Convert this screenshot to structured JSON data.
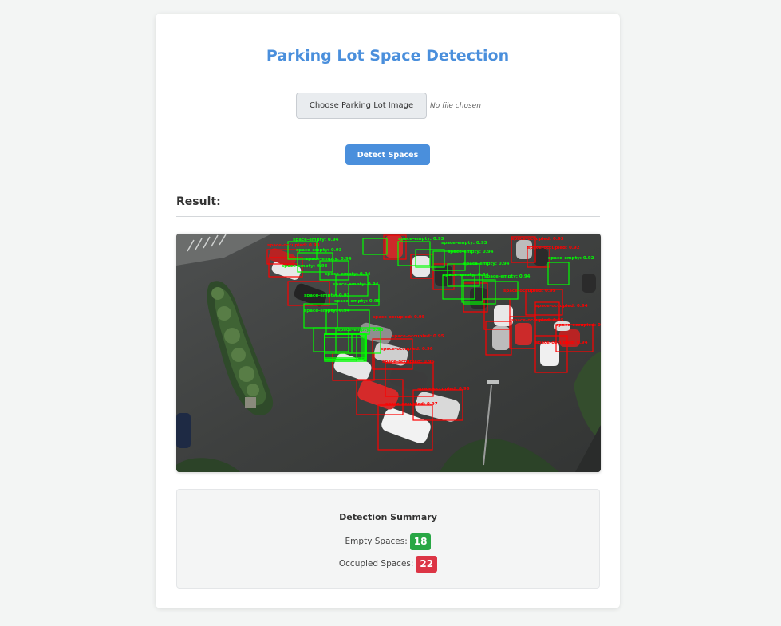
{
  "page": {
    "title": "Parking Lot Space Detection"
  },
  "upload": {
    "button_label": "Choose Parking Lot Image",
    "status_text": "No file chosen"
  },
  "actions": {
    "detect_label": "Detect Spaces"
  },
  "result": {
    "heading": "Result:",
    "image_description_labels": {
      "empty_label": "space-empty",
      "occupied_label": "space-occupied"
    }
  },
  "summary": {
    "title": "Detection Summary",
    "empty_label": "Empty Spaces:",
    "empty_count": "18",
    "occupied_label": "Occupied Spaces:",
    "occupied_count": "22"
  },
  "colors": {
    "accent": "#4a8fdc",
    "empty_badge": "#28a745",
    "occupied_badge": "#dc3545",
    "box_empty": "#00ff00",
    "box_occupied": "#ff0000"
  }
}
